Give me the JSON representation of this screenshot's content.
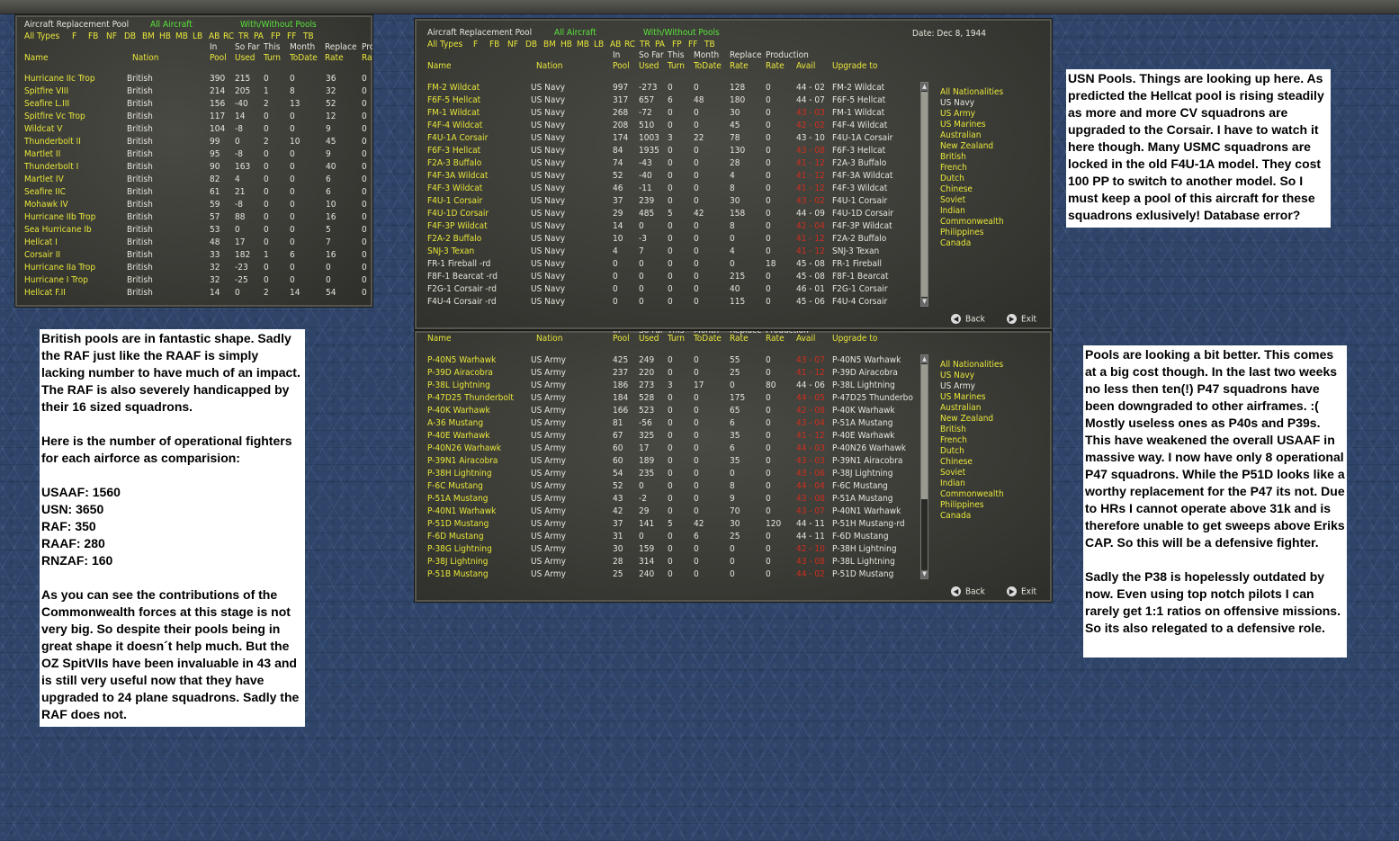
{
  "common": {
    "title": "Aircraft Replacement Pool",
    "all_aircraft": "All Aircraft",
    "with_without": "With/Without Pools",
    "all_types": "All Types",
    "types": [
      "F",
      "FB",
      "NF",
      "DB",
      "BM",
      "HB",
      "MB",
      "LB",
      "AB",
      "RC",
      "TR",
      "PA",
      "FP",
      "FF",
      "TB"
    ],
    "col": {
      "name": "Name",
      "nation": "Nation",
      "in1": "In",
      "in2": "Pool",
      "sofar1": "So Far",
      "sofar2": "Used",
      "this1": "This",
      "this2": "Turn",
      "month1": "Month",
      "month2": "ToDate",
      "replace1": "Replace",
      "replace2": "Rate",
      "prod1": "Production",
      "prod2": "Rate",
      "pro_trunc": "Pro",
      "ra_trunc": "Ra",
      "avail": "Avail",
      "upgrade": "Upgrade to"
    },
    "back": "Back",
    "exit": "Exit",
    "nationalities": [
      "All Nationalities",
      "US Navy",
      "US Army",
      "US Marines",
      "Australian",
      "New Zealand",
      "British",
      "French",
      "Dutch",
      "Chinese",
      "Soviet",
      "Indian",
      "Commonwealth",
      "Philippines",
      "Canada"
    ]
  },
  "british_panel": {
    "rows": [
      {
        "name": "Hurricane IIc Trop",
        "nation": "British",
        "pool": "390",
        "used": "215",
        "turn": "0",
        "month": "0",
        "rate": "36",
        "prod": "0"
      },
      {
        "name": "Spitfire VIII",
        "nation": "British",
        "pool": "214",
        "used": "205",
        "turn": "1",
        "month": "8",
        "rate": "32",
        "prod": "0"
      },
      {
        "name": "Seafire L.III",
        "nation": "British",
        "pool": "156",
        "used": "-40",
        "turn": "2",
        "month": "13",
        "rate": "52",
        "prod": "0"
      },
      {
        "name": "Spitfire Vc Trop",
        "nation": "British",
        "pool": "117",
        "used": "14",
        "turn": "0",
        "month": "0",
        "rate": "12",
        "prod": "0"
      },
      {
        "name": "Wildcat V",
        "nation": "British",
        "pool": "104",
        "used": "-8",
        "turn": "0",
        "month": "0",
        "rate": "9",
        "prod": "0"
      },
      {
        "name": "Thunderbolt II",
        "nation": "British",
        "pool": "99",
        "used": "0",
        "turn": "2",
        "month": "10",
        "rate": "45",
        "prod": "0"
      },
      {
        "name": "Martlet II",
        "nation": "British",
        "pool": "95",
        "used": "-8",
        "turn": "0",
        "month": "0",
        "rate": "9",
        "prod": "0"
      },
      {
        "name": "Thunderbolt I",
        "nation": "British",
        "pool": "90",
        "used": "163",
        "turn": "0",
        "month": "0",
        "rate": "40",
        "prod": "0"
      },
      {
        "name": "Martlet IV",
        "nation": "British",
        "pool": "82",
        "used": "4",
        "turn": "0",
        "month": "0",
        "rate": "6",
        "prod": "0"
      },
      {
        "name": "Seafire IIC",
        "nation": "British",
        "pool": "61",
        "used": "21",
        "turn": "0",
        "month": "0",
        "rate": "6",
        "prod": "0"
      },
      {
        "name": "Mohawk IV",
        "nation": "British",
        "pool": "59",
        "used": "-8",
        "turn": "0",
        "month": "0",
        "rate": "10",
        "prod": "0"
      },
      {
        "name": "Hurricane IIb Trop",
        "nation": "British",
        "pool": "57",
        "used": "88",
        "turn": "0",
        "month": "0",
        "rate": "16",
        "prod": "0"
      },
      {
        "name": "Sea Hurricane Ib",
        "nation": "British",
        "pool": "53",
        "used": "0",
        "turn": "0",
        "month": "0",
        "rate": "5",
        "prod": "0"
      },
      {
        "name": "Hellcat I",
        "nation": "British",
        "pool": "48",
        "used": "17",
        "turn": "0",
        "month": "0",
        "rate": "7",
        "prod": "0"
      },
      {
        "name": "Corsair II",
        "nation": "British",
        "pool": "33",
        "used": "182",
        "turn": "1",
        "month": "6",
        "rate": "16",
        "prod": "0"
      },
      {
        "name": "Hurricane IIa Trop",
        "nation": "British",
        "pool": "32",
        "used": "-23",
        "turn": "0",
        "month": "0",
        "rate": "0",
        "prod": "0"
      },
      {
        "name": "Hurricane I Trop",
        "nation": "British",
        "pool": "32",
        "used": "-25",
        "turn": "0",
        "month": "0",
        "rate": "0",
        "prod": "0"
      },
      {
        "name": "Hellcat F.II",
        "nation": "British",
        "pool": "14",
        "used": "0",
        "turn": "2",
        "month": "14",
        "rate": "54",
        "prod": "0"
      }
    ]
  },
  "usn_panel": {
    "date": "Date: Dec 8, 1944",
    "rows": [
      {
        "name": "FM-2 Wildcat",
        "nation": "US Navy",
        "pool": "997",
        "used": "-273",
        "turn": "0",
        "month": "0",
        "rate": "128",
        "prod": "0",
        "avail": "44 - 02",
        "avail_red": false,
        "upgrade": "FM-2 Wildcat"
      },
      {
        "name": "F6F-5 Hellcat",
        "nation": "US Navy",
        "pool": "317",
        "used": "657",
        "turn": "6",
        "month": "48",
        "rate": "180",
        "prod": "0",
        "avail": "44 - 07",
        "avail_red": false,
        "upgrade": "F6F-5 Hellcat"
      },
      {
        "name": "FM-1 Wildcat",
        "nation": "US Navy",
        "pool": "268",
        "used": "-72",
        "turn": "0",
        "month": "0",
        "rate": "30",
        "prod": "0",
        "avail": "43 - 03",
        "avail_red": true,
        "upgrade": "FM-1 Wildcat"
      },
      {
        "name": "F4F-4 Wildcat",
        "nation": "US Navy",
        "pool": "208",
        "used": "510",
        "turn": "0",
        "month": "0",
        "rate": "45",
        "prod": "0",
        "avail": "42 - 02",
        "avail_red": true,
        "upgrade": "F4F-4 Wildcat"
      },
      {
        "name": "F4U-1A Corsair",
        "nation": "US Navy",
        "pool": "174",
        "used": "1003",
        "turn": "3",
        "month": "22",
        "rate": "78",
        "prod": "0",
        "avail": "43 - 10",
        "avail_red": false,
        "upgrade": "F4U-1A Corsair"
      },
      {
        "name": "F6F-3 Hellcat",
        "nation": "US Navy",
        "pool": "84",
        "used": "1935",
        "turn": "0",
        "month": "0",
        "rate": "130",
        "prod": "0",
        "avail": "43 - 08",
        "avail_red": true,
        "upgrade": "F6F-3 Hellcat"
      },
      {
        "name": "F2A-3 Buffalo",
        "nation": "US Navy",
        "pool": "74",
        "used": "-43",
        "turn": "0",
        "month": "0",
        "rate": "28",
        "prod": "0",
        "avail": "41 - 12",
        "avail_red": true,
        "upgrade": "F2A-3 Buffalo"
      },
      {
        "name": "F4F-3A Wildcat",
        "nation": "US Navy",
        "pool": "52",
        "used": "-40",
        "turn": "0",
        "month": "0",
        "rate": "4",
        "prod": "0",
        "avail": "41 - 12",
        "avail_red": true,
        "upgrade": "F4F-3A Wildcat"
      },
      {
        "name": "F4F-3 Wildcat",
        "nation": "US Navy",
        "pool": "46",
        "used": "-11",
        "turn": "0",
        "month": "0",
        "rate": "8",
        "prod": "0",
        "avail": "41 - 12",
        "avail_red": true,
        "upgrade": "F4F-3 Wildcat"
      },
      {
        "name": "F4U-1 Corsair",
        "nation": "US Navy",
        "pool": "37",
        "used": "239",
        "turn": "0",
        "month": "0",
        "rate": "30",
        "prod": "0",
        "avail": "43 - 02",
        "avail_red": true,
        "upgrade": "F4U-1 Corsair"
      },
      {
        "name": "F4U-1D Corsair",
        "nation": "US Navy",
        "pool": "29",
        "used": "485",
        "turn": "5",
        "month": "42",
        "rate": "158",
        "prod": "0",
        "avail": "44 - 09",
        "avail_red": false,
        "upgrade": "F4U-1D Corsair"
      },
      {
        "name": "F4F-3P Wildcat",
        "nation": "US Navy",
        "pool": "14",
        "used": "0",
        "turn": "0",
        "month": "0",
        "rate": "8",
        "prod": "0",
        "avail": "42 - 04",
        "avail_red": true,
        "upgrade": "F4F-3P Wildcat"
      },
      {
        "name": "F2A-2 Buffalo",
        "nation": "US Navy",
        "pool": "10",
        "used": "-3",
        "turn": "0",
        "month": "0",
        "rate": "0",
        "prod": "0",
        "avail": "41 - 12",
        "avail_red": true,
        "upgrade": "F2A-2 Buffalo"
      },
      {
        "name": "SNJ-3 Texan",
        "nation": "US Navy",
        "pool": "4",
        "used": "7",
        "turn": "0",
        "month": "0",
        "rate": "4",
        "prod": "0",
        "avail": "41 - 12",
        "avail_red": true,
        "upgrade": "SNJ-3 Texan"
      },
      {
        "name": "FR-1 Fireball -rd",
        "nation": "US Navy",
        "pool": "0",
        "used": "0",
        "turn": "0",
        "month": "0",
        "rate": "0",
        "prod": "18",
        "avail": "45 - 08",
        "avail_red": false,
        "upgrade": "FR-1 Fireball"
      },
      {
        "name": "F8F-1 Bearcat -rd",
        "nation": "US Navy",
        "pool": "0",
        "used": "0",
        "turn": "0",
        "month": "0",
        "rate": "215",
        "prod": "0",
        "avail": "45 - 08",
        "avail_red": false,
        "upgrade": "F8F-1 Bearcat"
      },
      {
        "name": "F2G-1 Corsair -rd",
        "nation": "US Navy",
        "pool": "0",
        "used": "0",
        "turn": "0",
        "month": "0",
        "rate": "40",
        "prod": "0",
        "avail": "46 - 01",
        "avail_red": false,
        "upgrade": "F2G-1 Corsair"
      },
      {
        "name": "F4U-4 Corsair -rd",
        "nation": "US Navy",
        "pool": "0",
        "used": "0",
        "turn": "0",
        "month": "0",
        "rate": "115",
        "prod": "0",
        "avail": "45 - 06",
        "avail_red": false,
        "upgrade": "F4U-4 Corsair"
      }
    ]
  },
  "usa_panel": {
    "rows": [
      {
        "name": "P-40N5 Warhawk",
        "nation": "US Army",
        "pool": "425",
        "used": "249",
        "turn": "0",
        "month": "0",
        "rate": "55",
        "prod": "0",
        "avail": "43 - 07",
        "avail_red": true,
        "upgrade": "P-40N5 Warhawk"
      },
      {
        "name": "P-39D Airacobra",
        "nation": "US Army",
        "pool": "237",
        "used": "220",
        "turn": "0",
        "month": "0",
        "rate": "25",
        "prod": "0",
        "avail": "41 - 12",
        "avail_red": true,
        "upgrade": "P-39D Airacobra"
      },
      {
        "name": "P-38L Lightning",
        "nation": "US Army",
        "pool": "186",
        "used": "273",
        "turn": "3",
        "month": "17",
        "rate": "0",
        "prod": "80",
        "avail": "44 - 06",
        "avail_red": false,
        "upgrade": "P-38L Lightning"
      },
      {
        "name": "P-47D25 Thunderbolt",
        "nation": "US Army",
        "pool": "184",
        "used": "528",
        "turn": "0",
        "month": "0",
        "rate": "175",
        "prod": "0",
        "avail": "44 - 05",
        "avail_red": true,
        "upgrade": "P-47D25 Thunderbo"
      },
      {
        "name": "P-40K Warhawk",
        "nation": "US Army",
        "pool": "166",
        "used": "523",
        "turn": "0",
        "month": "0",
        "rate": "65",
        "prod": "0",
        "avail": "42 - 08",
        "avail_red": true,
        "upgrade": "P-40K Warhawk"
      },
      {
        "name": "A-36 Mustang",
        "nation": "US Army",
        "pool": "81",
        "used": "-56",
        "turn": "0",
        "month": "0",
        "rate": "6",
        "prod": "0",
        "avail": "43 - 04",
        "avail_red": true,
        "upgrade": "P-51A Mustang"
      },
      {
        "name": "P-40E Warhawk",
        "nation": "US Army",
        "pool": "67",
        "used": "325",
        "turn": "0",
        "month": "0",
        "rate": "35",
        "prod": "0",
        "avail": "41 - 12",
        "avail_red": true,
        "upgrade": "P-40E Warhawk"
      },
      {
        "name": "P-40N26 Warhawk",
        "nation": "US Army",
        "pool": "60",
        "used": "17",
        "turn": "0",
        "month": "0",
        "rate": "6",
        "prod": "0",
        "avail": "44 - 03",
        "avail_red": true,
        "upgrade": "P-40N26 Warhawk"
      },
      {
        "name": "P-39N1 Airacobra",
        "nation": "US Army",
        "pool": "60",
        "used": "189",
        "turn": "0",
        "month": "0",
        "rate": "35",
        "prod": "0",
        "avail": "43 - 03",
        "avail_red": true,
        "upgrade": "P-39N1 Airacobra"
      },
      {
        "name": "P-38H Lightning",
        "nation": "US Army",
        "pool": "54",
        "used": "235",
        "turn": "0",
        "month": "0",
        "rate": "0",
        "prod": "0",
        "avail": "43 - 06",
        "avail_red": true,
        "upgrade": "P-38J Lightning"
      },
      {
        "name": "F-6C Mustang",
        "nation": "US Army",
        "pool": "52",
        "used": "0",
        "turn": "0",
        "month": "0",
        "rate": "8",
        "prod": "0",
        "avail": "44 - 04",
        "avail_red": true,
        "upgrade": "F-6C Mustang"
      },
      {
        "name": "P-51A Mustang",
        "nation": "US Army",
        "pool": "43",
        "used": "-2",
        "turn": "0",
        "month": "0",
        "rate": "9",
        "prod": "0",
        "avail": "43 - 08",
        "avail_red": true,
        "upgrade": "P-51A Mustang"
      },
      {
        "name": "P-40N1 Warhawk",
        "nation": "US Army",
        "pool": "42",
        "used": "29",
        "turn": "0",
        "month": "0",
        "rate": "70",
        "prod": "0",
        "avail": "43 - 07",
        "avail_red": true,
        "upgrade": "P-40N1 Warhawk"
      },
      {
        "name": "P-51D Mustang",
        "nation": "US Army",
        "pool": "37",
        "used": "141",
        "turn": "5",
        "month": "42",
        "rate": "30",
        "prod": "120",
        "avail": "44 - 11",
        "avail_red": false,
        "upgrade": "P-51H Mustang-rd"
      },
      {
        "name": "F-6D Mustang",
        "nation": "US Army",
        "pool": "31",
        "used": "0",
        "turn": "0",
        "month": "6",
        "rate": "25",
        "prod": "0",
        "avail": "44 - 11",
        "avail_red": false,
        "upgrade": "F-6D Mustang"
      },
      {
        "name": "P-38G Lightning",
        "nation": "US Army",
        "pool": "30",
        "used": "159",
        "turn": "0",
        "month": "0",
        "rate": "0",
        "prod": "0",
        "avail": "42 - 10",
        "avail_red": true,
        "upgrade": "P-38H Lightning"
      },
      {
        "name": "P-38J Lightning",
        "nation": "US Army",
        "pool": "28",
        "used": "314",
        "turn": "0",
        "month": "0",
        "rate": "0",
        "prod": "0",
        "avail": "43 - 08",
        "avail_red": true,
        "upgrade": "P-38L Lightning"
      },
      {
        "name": "P-51B Mustang",
        "nation": "US Army",
        "pool": "25",
        "used": "240",
        "turn": "0",
        "month": "0",
        "rate": "0",
        "prod": "0",
        "avail": "44 - 02",
        "avail_red": true,
        "upgrade": "P-51D Mustang"
      }
    ]
  },
  "notes": {
    "british": {
      "p1": "British pools are in fantastic shape. Sadly the RAF just like the RAAF is simply lacking number to have much of an impact. The RAF is also severely handicapped by their 16 sized squadrons.",
      "p2": "Here is the number of operational fighters for each airforce as comparision:",
      "stats": [
        "USAAF: 1560",
        "USN: 3650",
        "RAF: 350",
        "RAAF: 280",
        "RNZAF: 160"
      ],
      "p3": "As you can see the contributions of the Commonwealth forces at this stage is not very big. So despite their pools being in great shape it doesn´t help much. But the OZ SpitVIIs have been invaluable in 43 and is still very useful now that they have upgraded to 24 plane squadrons. Sadly the RAF does not."
    },
    "usn": "USN Pools. Things are looking up here. As predicted the Hellcat pool is rising steadily as more and more CV squadrons are upgraded to the Corsair. I have to watch it here though. Many USMC squadrons are locked in the old F4U-1A model. They cost 100 PP to switch to another model. So I must keep a pool of this aircraft for these squadrons exlusively! Database error?",
    "usa": {
      "p1": "Pools are looking a bit better. This comes at a big cost though. In the last two weeks no less then ten(!) P47 squadrons have been downgraded to other airframes. :( Mostly useless ones as P40s and P39s. This have weakened the overall USAAF in massive way. I now have only 8 operational P47 squadrons.  While the P51D looks like a worthy replacement for the P47 its not. Due to HRs I cannot operate above 31k and is therefore unable to get sweeps above Eriks CAP. So this will be a defensive fighter.",
      "p2": "Sadly the P38 is hopelessly outdated by now. Even using top notch pilots I can rarely get 1:1 ratios on offensive missions. So its also relegated to a defensive role."
    }
  }
}
